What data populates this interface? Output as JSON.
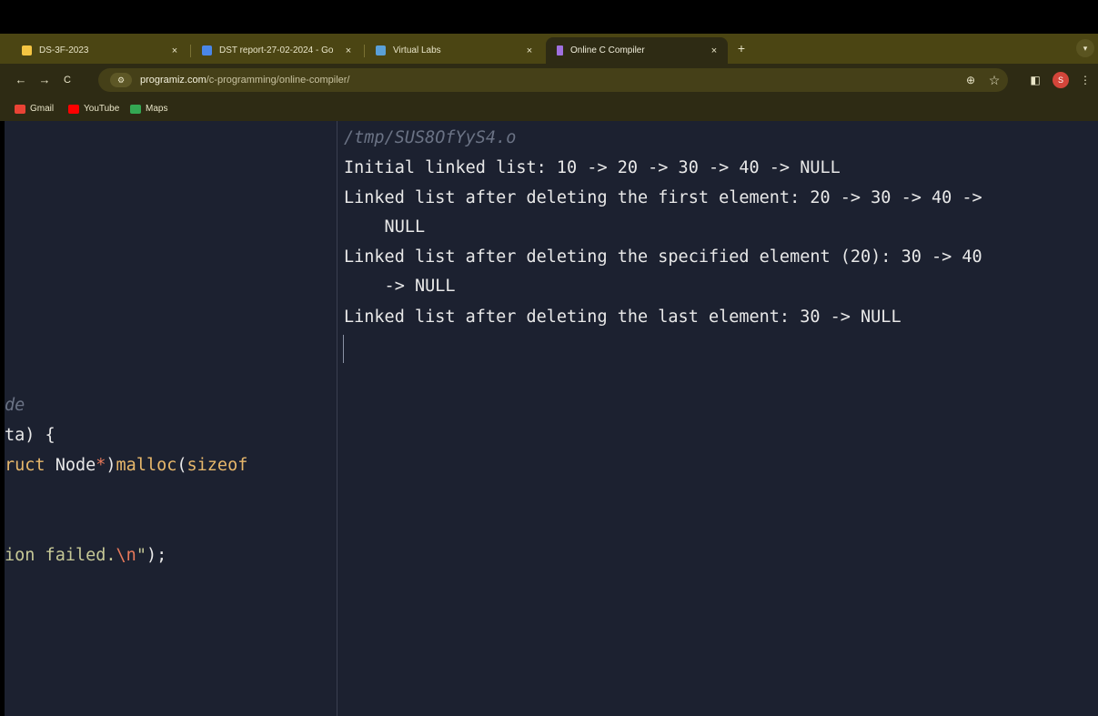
{
  "tabs": [
    {
      "title": "DS-3F-2023",
      "close": "×",
      "favicon_color": "#f4c542"
    },
    {
      "title": "DST report-27-02-2024 - Go",
      "close": "×",
      "favicon_color": "#4a86e8"
    },
    {
      "title": "Virtual Labs",
      "close": "×",
      "favicon_color": "#5aa0d8"
    },
    {
      "title": "Online C Compiler",
      "close": "×",
      "favicon_color": "#a070e0"
    }
  ],
  "new_tab_label": "+",
  "toolbar": {
    "back": "←",
    "forward": "→",
    "reload": "C",
    "url_host": "programiz.com",
    "url_path": "/c-programming/online-compiler/",
    "zoom_icon": "⊕",
    "star_icon": "☆",
    "avatar_letter": "S",
    "menu_icon": "⋮"
  },
  "bookmarks": [
    {
      "label": "Gmail",
      "color": "#ea4335"
    },
    {
      "label": "YouTube",
      "color": "#ff0000"
    },
    {
      "label": "Maps",
      "color": "#34a853"
    }
  ],
  "editor": {
    "line1_comment": "de",
    "line2": "ta) {",
    "line3_kw": "ruct",
    "line3_type": " Node",
    "line3_star": "*",
    "line3_close": ")",
    "line3_fn": "malloc",
    "line3_paren": "(",
    "line3_kw2": "sizeof",
    "line4_str": "ion failed.",
    "line4_esc": "\\n",
    "line4_str2": "\"",
    "line4_end": ");"
  },
  "output": {
    "path": "/tmp/SUS8OfYyS4.o",
    "lines": [
      "Initial linked list: 10 -> 20 -> 30 -> 40 -> NULL",
      "Linked list after deleting the first element: 20 -> 30 -> 40 ->",
      "    NULL",
      "Linked list after deleting the specified element (20): 30 -> 40",
      "    -> NULL",
      "Linked list after deleting the last element: 30 -> NULL"
    ]
  }
}
